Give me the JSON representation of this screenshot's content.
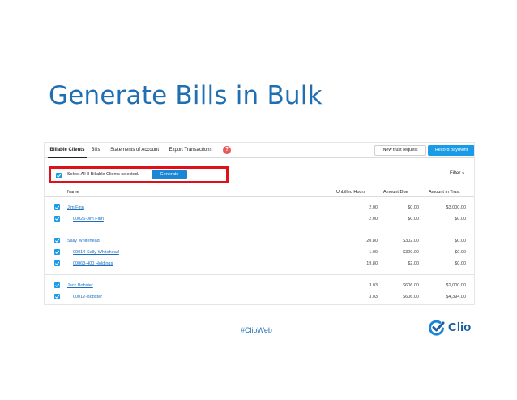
{
  "slide": {
    "title": "Generate Bills in Bulk",
    "hashtag": "#ClioWeb",
    "logo_text": "Clio"
  },
  "tabs": [
    {
      "label": "Billable Clients",
      "active": true
    },
    {
      "label": "Bills",
      "active": false
    },
    {
      "label": "Statements of Account",
      "active": false
    },
    {
      "label": "Export Transactions",
      "active": false
    }
  ],
  "help_icon": "?",
  "actions": {
    "new_trust_request": "New trust request",
    "record_payment": "Record payment"
  },
  "selection": {
    "label": "Select All 8 Billable Clients selected.",
    "generate": "Generate",
    "filter": "Filter ›"
  },
  "table": {
    "headers": [
      "Name",
      "Unbilled Hours",
      "Amount Due",
      "Amount in Trust"
    ],
    "rows": [
      {
        "name": "Jim Finn",
        "hours": "2.00",
        "due": "$0.00",
        "trust": "$3,000.00"
      },
      {
        "name": "00026-Jim Finn",
        "hours": "2.00",
        "due": "$0.00",
        "trust": "$0.00"
      },
      {
        "name": "Sally Whitehead",
        "hours": "20.80",
        "due": "$302.00",
        "trust": "$0.00"
      },
      {
        "name": "00014-Sally Whitehead",
        "hours": "1.00",
        "due": "$300.00",
        "trust": "$0.00"
      },
      {
        "name": "00063-400 Holdings",
        "hours": "19.80",
        "due": "$2.00",
        "trust": "$0.00"
      },
      {
        "name": "Jack Bobster",
        "hours": "3.03",
        "due": "$606.00",
        "trust": "$2,000.00"
      },
      {
        "name": "00012-Bobster",
        "hours": "3.03",
        "due": "$606.00",
        "trust": "$4,394.00"
      }
    ]
  },
  "colors": {
    "accent": "#1a9be8",
    "highlight_border": "#e0101b",
    "title": "#1f6fb2"
  }
}
